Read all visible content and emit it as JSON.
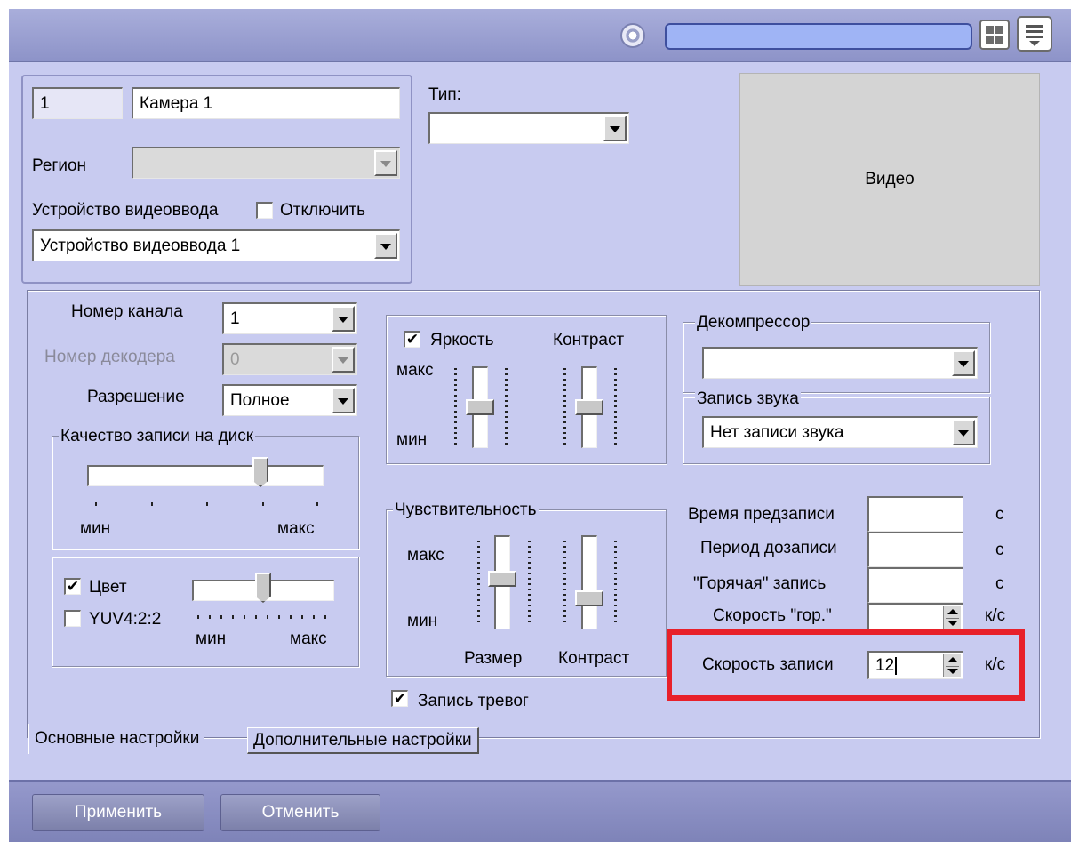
{
  "camera": {
    "id": "1",
    "name": "Камера 1",
    "region_label": "Регион",
    "region_value": "",
    "device_label": "Устройство видеоввода",
    "disable_label": "Отключить",
    "disable_checked": false,
    "device_value": "Устройство видеоввода 1"
  },
  "type": {
    "label": "Тип:",
    "value": ""
  },
  "video_preview": {
    "label": "Видео"
  },
  "channel": {
    "channel_label": "Номер канала",
    "channel_value": "1",
    "decoder_label": "Номер декодера",
    "decoder_value": "0",
    "resolution_label": "Разрешение",
    "resolution_value": "Полное"
  },
  "disk_quality": {
    "legend": "Качество записи на диск",
    "min_label": "мин",
    "max_label": "макс",
    "level": 0.75
  },
  "color": {
    "color_label": "Цвет",
    "color_checked": true,
    "yuv_label": "YUV4:2:2",
    "yuv_checked": false,
    "min_label": "мин",
    "max_label": "макс",
    "level": 0.5
  },
  "image": {
    "brightness_label": "Яркость",
    "brightness_checked": true,
    "contrast_label": "Контраст",
    "max_label": "макс",
    "min_label": "мин",
    "brightness_level": 0.5,
    "contrast_level": 0.5
  },
  "sensitivity": {
    "legend": "Чувствительность",
    "max_label": "макс",
    "min_label": "мин",
    "size_label": "Размер",
    "contrast_label": "Контраст",
    "size_level": 0.55,
    "contrast_level": 0.3
  },
  "alarm_recording": {
    "label": "Запись тревог",
    "checked": true
  },
  "decompressor": {
    "legend": "Декомпрессор",
    "value": ""
  },
  "audio_recording": {
    "legend": "Запись звука",
    "value": "Нет записи звука"
  },
  "timing": {
    "prerecord_label": "Время предзаписи",
    "prerecord_value": "",
    "prerecord_unit": "с",
    "postrecord_label": "Период дозаписи",
    "postrecord_value": "",
    "postrecord_unit": "с",
    "hot_label": "\"Горячая\" запись",
    "hot_value": "",
    "hot_unit": "с",
    "hot_speed_label": "Скорость \"гор.\"",
    "hot_speed_value": "",
    "hot_speed_unit": "к/с",
    "record_speed_label": "Скорость записи",
    "record_speed_value": "12",
    "record_speed_unit": "к/с"
  },
  "tabs": [
    {
      "label": "Основные настройки",
      "active": true
    },
    {
      "label": "Дополнительные настройки",
      "active": false
    }
  ],
  "buttons": {
    "apply": "Применить",
    "cancel": "Отменить"
  },
  "colors": {
    "highlight": "#e8202a",
    "window_bg": "#c8cbf0",
    "title_bar": "#9a9fd2"
  }
}
